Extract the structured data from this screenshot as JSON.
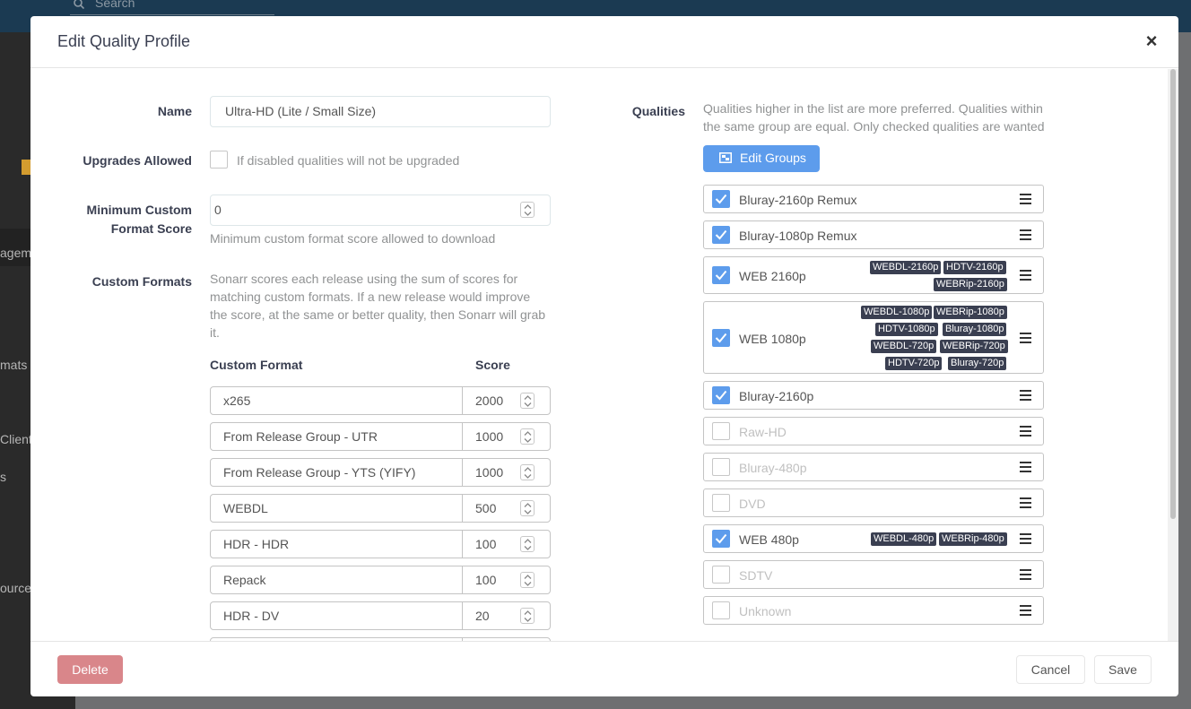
{
  "background": {
    "search_placeholder": "Search",
    "sidebar_fragments": [
      "agemen",
      "mats",
      "Clients",
      "s",
      "ource"
    ]
  },
  "modal": {
    "title": "Edit Quality Profile",
    "close": "×"
  },
  "form": {
    "name_label": "Name",
    "name_value": "Ultra-HD (Lite / Small Size)",
    "upgrades_label": "Upgrades Allowed",
    "upgrades_checked": false,
    "upgrades_help": "If disabled qualities will not be upgraded",
    "min_score_label_line1": "Minimum Custom",
    "min_score_label_line2": "Format Score",
    "min_score_value": "0",
    "min_score_help": "Minimum custom format score allowed to download",
    "custom_formats_label": "Custom Formats",
    "custom_formats_help_lines": [
      "Sonarr scores each release using the sum of scores for",
      "matching custom formats. If a new release would improve",
      "the score, at the same or better quality, then Sonarr will grab",
      "it."
    ],
    "cf_col_format": "Custom Format",
    "cf_col_score": "Score",
    "custom_formats": [
      {
        "name": "x265",
        "score": "2000"
      },
      {
        "name": "From Release Group - UTR",
        "score": "1000"
      },
      {
        "name": "From Release Group - YTS (YIFY)",
        "score": "1000"
      },
      {
        "name": "WEBDL",
        "score": "500"
      },
      {
        "name": "HDR - HDR",
        "score": "100"
      },
      {
        "name": "Repack",
        "score": "100"
      },
      {
        "name": "HDR - DV",
        "score": "20"
      }
    ]
  },
  "qualities": {
    "label": "Qualities",
    "help_line1": "Qualities higher in the list are more preferred. Qualities within",
    "help_line2": "the same group are equal. Only checked qualities are wanted",
    "edit_groups_label": "Edit Groups",
    "items": [
      {
        "name": "Bluray-2160p Remux",
        "checked": true,
        "tags": []
      },
      {
        "name": "Bluray-1080p Remux",
        "checked": true,
        "tags": []
      },
      {
        "name": "WEB 2160p",
        "checked": true,
        "tags": [
          "WEBDL-2160p",
          "HDTV-2160p",
          "WEBRip-2160p"
        ]
      },
      {
        "name": "WEB 1080p",
        "checked": true,
        "tags": [
          "WEBDL-1080p",
          "WEBRip-1080p",
          "HDTV-1080p",
          "Bluray-1080p",
          "WEBDL-720p",
          "WEBRip-720p",
          "HDTV-720p",
          "Bluray-720p"
        ]
      },
      {
        "name": "Bluray-2160p",
        "checked": true,
        "tags": []
      },
      {
        "name": "Raw-HD",
        "checked": false,
        "tags": []
      },
      {
        "name": "Bluray-480p",
        "checked": false,
        "tags": []
      },
      {
        "name": "DVD",
        "checked": false,
        "tags": []
      },
      {
        "name": "WEB 480p",
        "checked": true,
        "tags": [
          "WEBDL-480p",
          "WEBRip-480p"
        ]
      },
      {
        "name": "SDTV",
        "checked": false,
        "tags": []
      },
      {
        "name": "Unknown",
        "checked": false,
        "tags": []
      }
    ]
  },
  "footer": {
    "delete_label": "Delete",
    "cancel_label": "Cancel",
    "save_label": "Save"
  },
  "colors": {
    "primary": "#5d9cec",
    "danger": "#d9868a",
    "tag_bg": "#3a3f51"
  }
}
